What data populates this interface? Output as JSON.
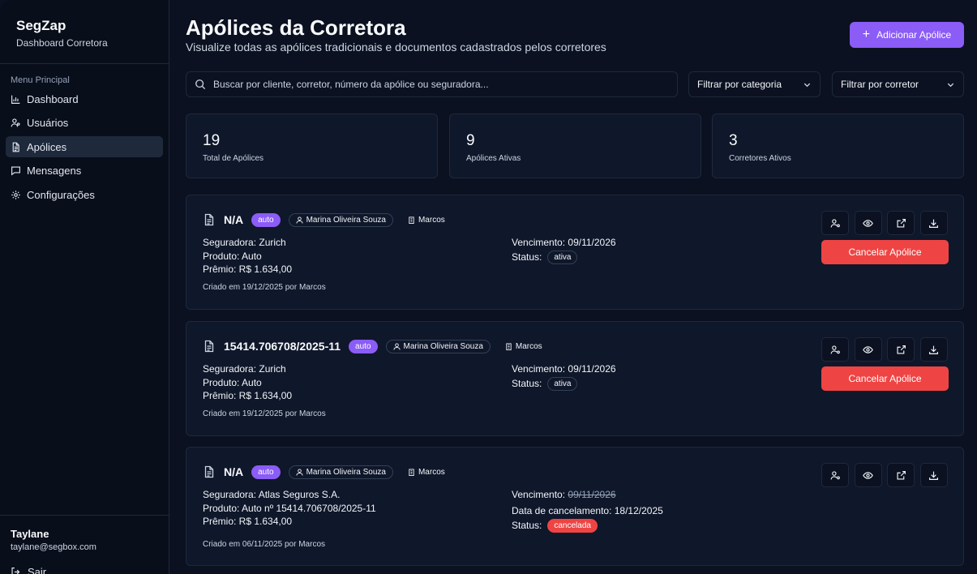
{
  "sidebar": {
    "brand_title": "SegZap",
    "brand_subtitle": "Dashboard Corretora",
    "menu_label": "Menu Principal",
    "items": [
      {
        "label": "Dashboard",
        "icon": "chart-icon"
      },
      {
        "label": "Usuários",
        "icon": "users-icon"
      },
      {
        "label": "Apólices",
        "icon": "document-icon",
        "active": true
      },
      {
        "label": "Mensagens",
        "icon": "message-icon"
      },
      {
        "label": "Configurações",
        "icon": "gear-icon"
      }
    ],
    "user_name": "Taylane",
    "user_email": "taylane@segbox.com",
    "logout_label": "Sair"
  },
  "header": {
    "title": "Apólices da Corretora",
    "subtitle": "Visualize todas as apólices tradicionais e documentos cadastrados pelos corretores",
    "add_button": "Adicionar Apólice"
  },
  "search": {
    "placeholder": "Buscar por cliente, corretor, número da apólice ou seguradora..."
  },
  "filters": {
    "category": "Filtrar por categoria",
    "broker": "Filtrar por corretor"
  },
  "stats": [
    {
      "value": "19",
      "label": "Total de Apólices"
    },
    {
      "value": "9",
      "label": "Apólices Ativas"
    },
    {
      "value": "3",
      "label": "Corretores Ativos"
    }
  ],
  "policies": [
    {
      "number": "N/A",
      "category": "auto",
      "client": "Marina Oliveira Souza",
      "broker": "Marcos",
      "insurer": "Seguradora: Zurich",
      "product": "Produto: Auto",
      "premium": "Prêmio: R$ 1.634,00",
      "due_label": "Vencimento:",
      "due": "09/11/2026",
      "status_label": "Status:",
      "status": "ativa",
      "created": "Criado em 19/12/2025 por Marcos",
      "cancel_label": "Cancelar Apólice"
    },
    {
      "number": "15414.706708/2025-11",
      "category": "auto",
      "client": "Marina Oliveira Souza",
      "broker": "Marcos",
      "insurer": "Seguradora: Zurich",
      "product": "Produto: Auto",
      "premium": "Prêmio: R$ 1.634,00",
      "due_label": "Vencimento:",
      "due": "09/11/2026",
      "status_label": "Status:",
      "status": "ativa",
      "created": "Criado em 19/12/2025 por Marcos",
      "cancel_label": "Cancelar Apólice"
    },
    {
      "number": "N/A",
      "category": "auto",
      "client": "Marina Oliveira Souza",
      "broker": "Marcos",
      "insurer": "Seguradora: Atlas Seguros S.A.",
      "product": "Produto: Auto nº 15414.706708/2025-11",
      "premium": "Prêmio: R$ 1.634,00",
      "due_label": "Vencimento:",
      "due": "09/11/2026",
      "cancel_date": "Data de cancelamento: 18/12/2025",
      "status_label": "Status:",
      "status": "cancelada",
      "created": "Criado em 06/11/2025 por Marcos"
    }
  ],
  "colors": {
    "accent": "#8b5cf6",
    "danger": "#ef4444",
    "background": "#0b1120",
    "card": "#0f172a"
  }
}
